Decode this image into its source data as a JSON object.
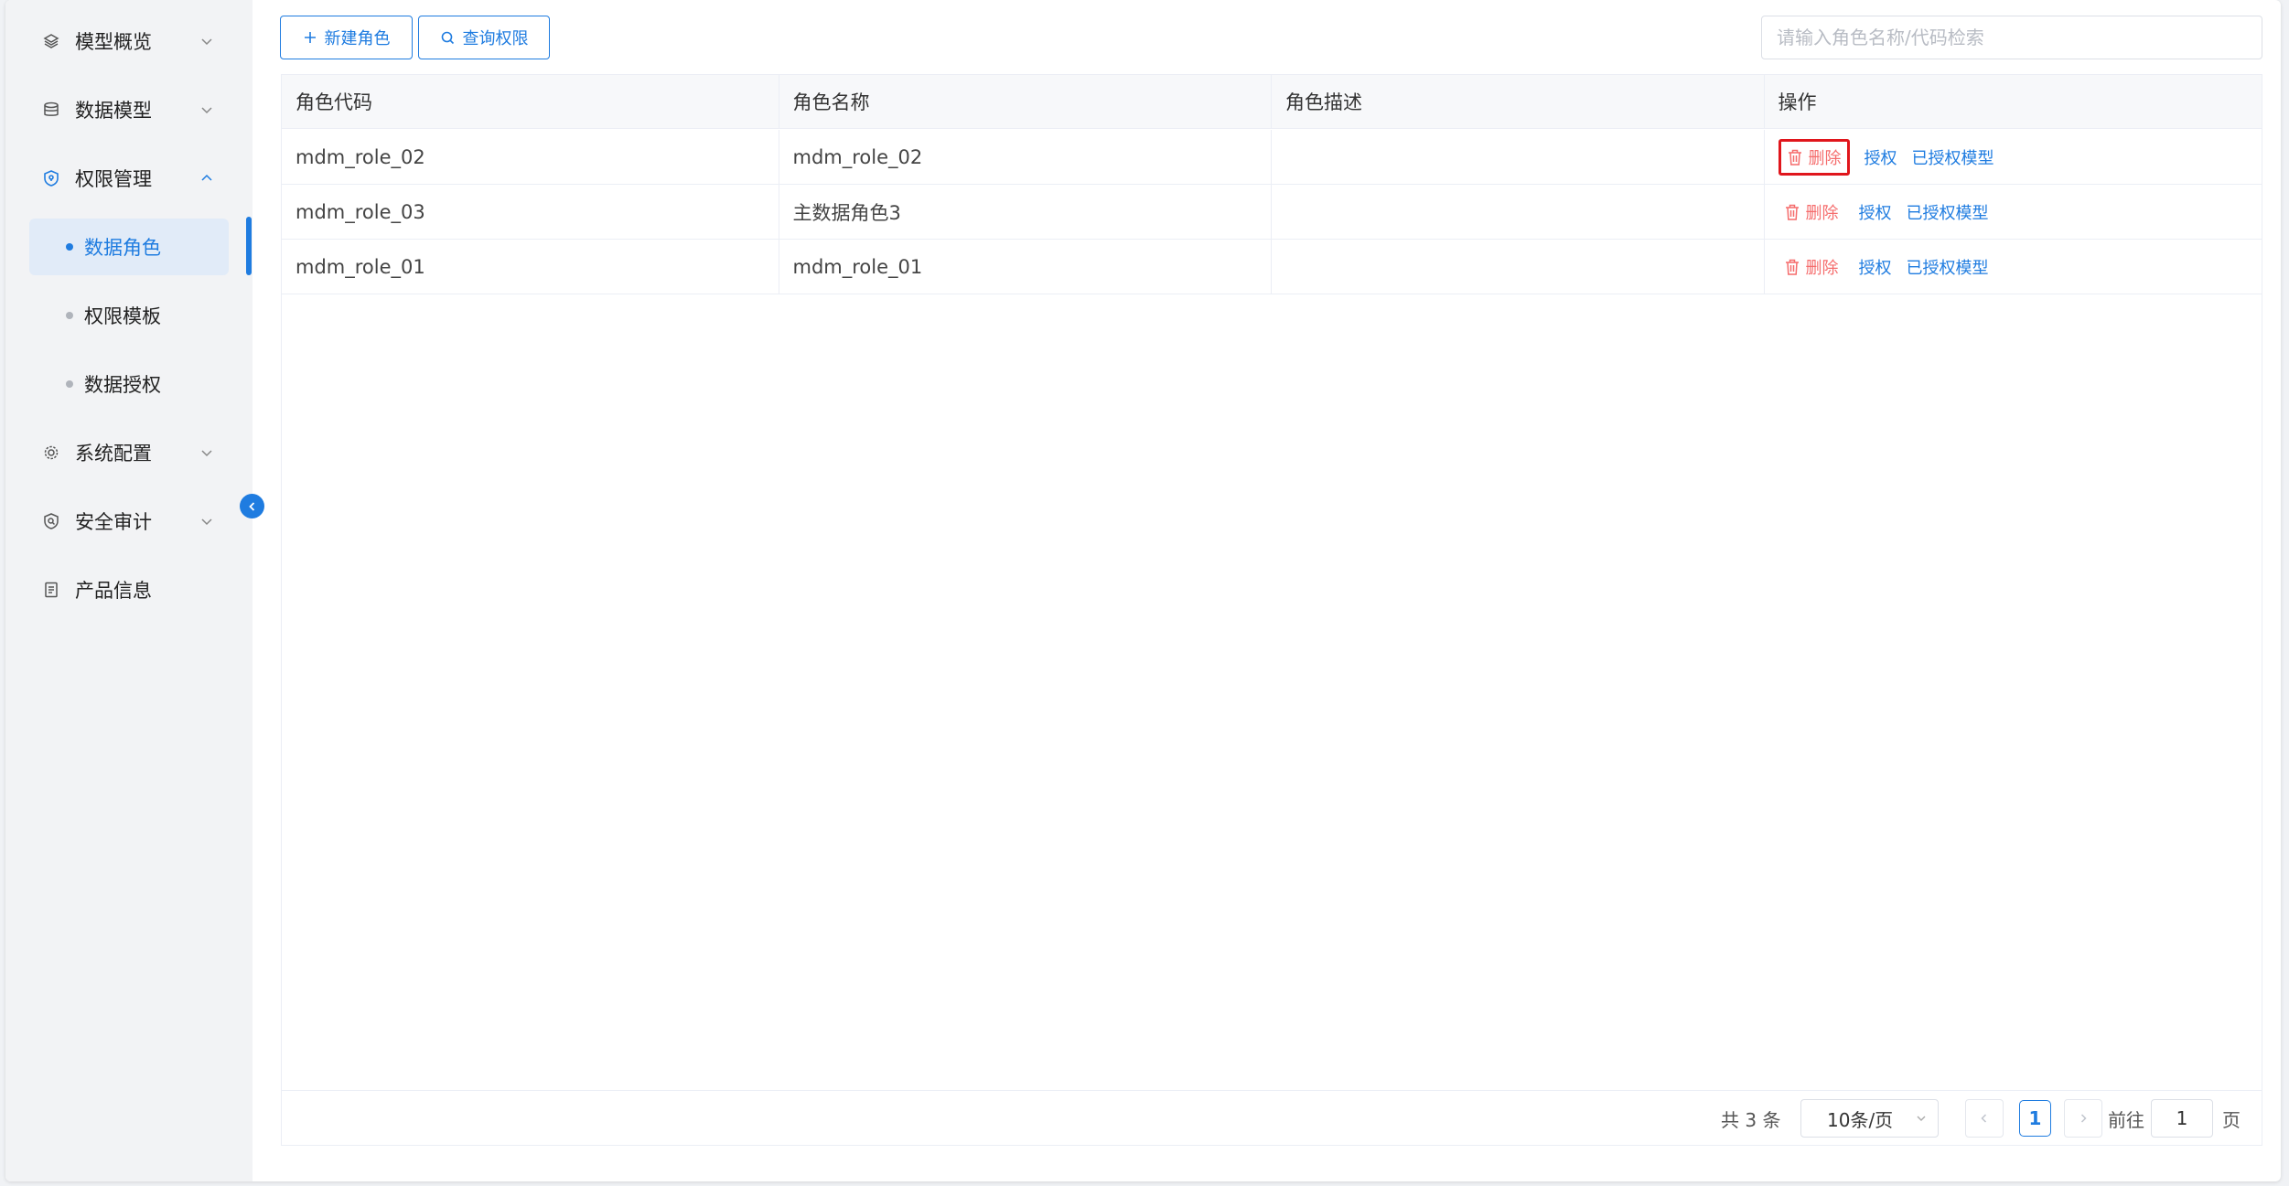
{
  "sidebar": {
    "items": [
      {
        "label": "模型概览",
        "icon": "layers-icon",
        "expanded": false
      },
      {
        "label": "数据模型",
        "icon": "database-icon",
        "expanded": false
      },
      {
        "label": "权限管理",
        "icon": "shield-icon",
        "expanded": true
      },
      {
        "label": "系统配置",
        "icon": "settings-icon",
        "expanded": false
      },
      {
        "label": "安全审计",
        "icon": "audit-icon",
        "expanded": false
      },
      {
        "label": "产品信息",
        "icon": "document-icon"
      }
    ],
    "sub_items": [
      {
        "label": "数据角色",
        "active": true
      },
      {
        "label": "权限模板",
        "active": false
      },
      {
        "label": "数据授权",
        "active": false
      }
    ]
  },
  "toolbar": {
    "new_role_label": "新建角色",
    "query_permission_label": "查询权限",
    "search_placeholder": "请输入角色名称/代码检索"
  },
  "table": {
    "columns": [
      "角色代码",
      "角色名称",
      "角色描述",
      "操作"
    ],
    "rows": [
      {
        "code": "mdm_role_02",
        "name": "mdm_role_02",
        "desc": ""
      },
      {
        "code": "mdm_role_03",
        "name": "主数据角色3",
        "desc": ""
      },
      {
        "code": "mdm_role_01",
        "name": "mdm_role_01",
        "desc": ""
      }
    ],
    "actions": {
      "delete": "删除",
      "authorize": "授权",
      "authorized_models": "已授权模型"
    }
  },
  "pagination": {
    "total_text": "共 3 条",
    "page_size": "10条/页",
    "current_page": "1",
    "goto_label": "前往",
    "goto_value": "1",
    "page_suffix": "页"
  },
  "colors": {
    "accent": "#1f7ce0",
    "danger": "#f56c6c",
    "highlight": "#e0161c"
  }
}
